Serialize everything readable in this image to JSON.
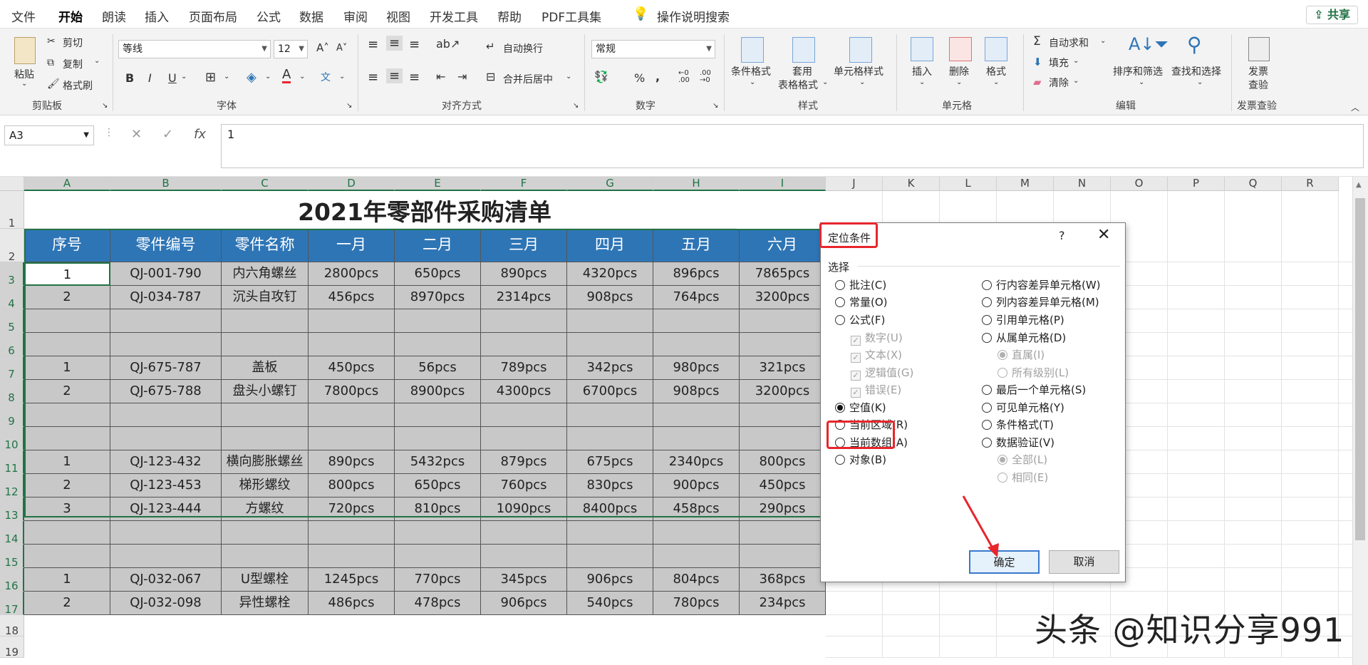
{
  "menu_tabs": [
    "文件",
    "开始",
    "朗读",
    "插入",
    "页面布局",
    "公式",
    "数据",
    "审阅",
    "视图",
    "开发工具",
    "帮助",
    "PDF工具集"
  ],
  "search_hint": "操作说明搜索",
  "share_label": "共享",
  "ribbon": {
    "clipboard": {
      "paste": "粘贴",
      "cut": "剪切",
      "copy": "复制",
      "format_painter": "格式刷",
      "group": "剪贴板"
    },
    "font": {
      "name": "等线",
      "size": "12",
      "group": "字体"
    },
    "alignment": {
      "wrap": "自动换行",
      "merge": "合并后居中",
      "group": "对齐方式"
    },
    "number": {
      "format": "常规",
      "group": "数字"
    },
    "styles": {
      "conditional": "条件格式",
      "table_l1": "套用",
      "table_l2": "表格格式",
      "cell_style": "单元格样式",
      "group": "样式"
    },
    "cells": {
      "insert": "插入",
      "delete": "删除",
      "format": "格式",
      "group": "单元格"
    },
    "editing": {
      "autosum": "自动求和",
      "fill": "填充",
      "clear": "清除",
      "sort": "排序和筛选",
      "find": "查找和选择",
      "group": "编辑"
    },
    "invoice": {
      "l1": "发票",
      "l2": "查验",
      "group": "发票查验"
    }
  },
  "formula_bar": {
    "cell_ref": "A3",
    "content": "1"
  },
  "columns": [
    "A",
    "B",
    "C",
    "D",
    "E",
    "F",
    "G",
    "H",
    "I",
    "J",
    "K",
    "L",
    "M",
    "N",
    "O",
    "P",
    "Q",
    "R"
  ],
  "rows": [
    "1",
    "2",
    "3",
    "4",
    "5",
    "6",
    "7",
    "8",
    "9",
    "10",
    "11",
    "12",
    "13",
    "14",
    "15",
    "16",
    "17",
    "18",
    "19"
  ],
  "sheet": {
    "title": "2021年零部件采购清单",
    "headers": [
      "序号",
      "零件编号",
      "零件名称",
      "一月",
      "二月",
      "三月",
      "四月",
      "五月",
      "六月"
    ],
    "data": [
      [
        "1",
        "QJ-001-790",
        "内六角螺丝",
        "2800pcs",
        "650pcs",
        "890pcs",
        "4320pcs",
        "896pcs",
        "7865pcs"
      ],
      [
        "2",
        "QJ-034-787",
        "沉头自攻钉",
        "456pcs",
        "8970pcs",
        "2314pcs",
        "908pcs",
        "764pcs",
        "3200pcs"
      ],
      [
        "",
        "",
        "",
        "",
        "",
        "",
        "",
        "",
        ""
      ],
      [
        "",
        "",
        "",
        "",
        "",
        "",
        "",
        "",
        ""
      ],
      [
        "1",
        "QJ-675-787",
        "盖板",
        "450pcs",
        "56pcs",
        "789pcs",
        "342pcs",
        "980pcs",
        "321pcs"
      ],
      [
        "2",
        "QJ-675-788",
        "盘头小螺钉",
        "7800pcs",
        "8900pcs",
        "4300pcs",
        "6700pcs",
        "908pcs",
        "3200pcs"
      ],
      [
        "",
        "",
        "",
        "",
        "",
        "",
        "",
        "",
        ""
      ],
      [
        "",
        "",
        "",
        "",
        "",
        "",
        "",
        "",
        ""
      ],
      [
        "1",
        "QJ-123-432",
        "横向膨胀螺丝",
        "890pcs",
        "5432pcs",
        "879pcs",
        "675pcs",
        "2340pcs",
        "800pcs"
      ],
      [
        "2",
        "QJ-123-453",
        "梯形螺纹",
        "800pcs",
        "650pcs",
        "760pcs",
        "830pcs",
        "900pcs",
        "450pcs"
      ],
      [
        "3",
        "QJ-123-444",
        "方螺纹",
        "720pcs",
        "810pcs",
        "1090pcs",
        "8400pcs",
        "458pcs",
        "290pcs"
      ],
      [
        "",
        "",
        "",
        "",
        "",
        "",
        "",
        "",
        ""
      ],
      [
        "",
        "",
        "",
        "",
        "",
        "",
        "",
        "",
        ""
      ],
      [
        "1",
        "QJ-032-067",
        "U型螺栓",
        "1245pcs",
        "770pcs",
        "345pcs",
        "906pcs",
        "804pcs",
        "368pcs"
      ],
      [
        "2",
        "QJ-032-098",
        "异性螺栓",
        "486pcs",
        "478pcs",
        "906pcs",
        "540pcs",
        "780pcs",
        "234pcs"
      ]
    ]
  },
  "dialog": {
    "title": "定位条件",
    "help": "?",
    "close": "✕",
    "legend": "选择",
    "left_options": [
      {
        "label": "批注(C)",
        "kind": "radio",
        "state": "off"
      },
      {
        "label": "常量(O)",
        "kind": "radio",
        "state": "off"
      },
      {
        "label": "公式(F)",
        "kind": "radio",
        "state": "off"
      },
      {
        "label": "数字(U)",
        "kind": "check",
        "state": "disabled"
      },
      {
        "label": "文本(X)",
        "kind": "check",
        "state": "disabled"
      },
      {
        "label": "逻辑值(G)",
        "kind": "check",
        "state": "disabled"
      },
      {
        "label": "错误(E)",
        "kind": "check",
        "state": "disabled"
      },
      {
        "label": "空值(K)",
        "kind": "radio",
        "state": "on"
      },
      {
        "label": "当前区域(R)",
        "kind": "radio",
        "state": "off"
      },
      {
        "label": "当前数组(A)",
        "kind": "radio",
        "state": "off"
      },
      {
        "label": "对象(B)",
        "kind": "radio",
        "state": "off"
      }
    ],
    "right_options": [
      {
        "label": "行内容差异单元格(W)",
        "kind": "radio",
        "state": "off"
      },
      {
        "label": "列内容差异单元格(M)",
        "kind": "radio",
        "state": "off"
      },
      {
        "label": "引用单元格(P)",
        "kind": "radio",
        "state": "off"
      },
      {
        "label": "从属单元格(D)",
        "kind": "radio",
        "state": "off"
      },
      {
        "label": "直属(I)",
        "kind": "radio",
        "state": "disabled-on"
      },
      {
        "label": "所有级别(L)",
        "kind": "radio",
        "state": "disabled"
      },
      {
        "label": "最后一个单元格(S)",
        "kind": "radio",
        "state": "off"
      },
      {
        "label": "可见单元格(Y)",
        "kind": "radio",
        "state": "off"
      },
      {
        "label": "条件格式(T)",
        "kind": "radio",
        "state": "off"
      },
      {
        "label": "数据验证(V)",
        "kind": "radio",
        "state": "off"
      },
      {
        "label": "全部(L)",
        "kind": "radio",
        "state": "disabled-on"
      },
      {
        "label": "相同(E)",
        "kind": "radio",
        "state": "disabled"
      }
    ],
    "ok": "确定",
    "cancel": "取消"
  },
  "watermark": "头条 @知识分享991",
  "colors": {
    "accent": "#217346",
    "header_fill": "#2e75b6",
    "data_fill": "#c8c8c8",
    "highlight": "#e8262c"
  }
}
